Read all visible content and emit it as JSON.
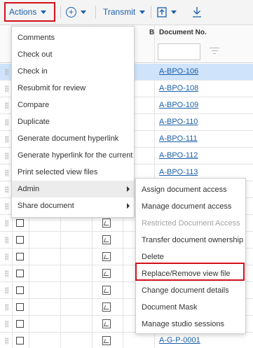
{
  "toolbar": {
    "actions_label": "Actions",
    "add_symbol": "+",
    "transmit_label": "Transmit"
  },
  "grid": {
    "header_partial": "B",
    "doc_no_header": "Document No.",
    "rows": [
      {
        "doc": "A-BPO-106",
        "selected": true
      },
      {
        "doc": "A-BPO-108"
      },
      {
        "doc": "A-BPO-109"
      },
      {
        "doc": "A-BPO-110"
      },
      {
        "doc": "A-BPO-111"
      },
      {
        "doc": "A-BPO-112"
      },
      {
        "doc": "A-BPO-113"
      },
      {
        "doc": ""
      },
      {
        "doc": ""
      },
      {
        "doc": ""
      },
      {
        "doc": ""
      },
      {
        "doc": ""
      },
      {
        "doc": ""
      },
      {
        "doc": ""
      },
      {
        "doc": ""
      },
      {
        "doc": ""
      },
      {
        "doc": "A-G-P-0001"
      }
    ]
  },
  "actions_menu": {
    "items": [
      "Comments",
      "Check out",
      "Check in",
      "Resubmit for review",
      "Compare",
      "Duplicate",
      "Generate document hyperlink",
      "Generate hyperlink for the current r...",
      "Print selected view files",
      "Admin",
      "Share document"
    ]
  },
  "admin_menu": {
    "items": [
      "Assign document access",
      "Manage document access",
      "Restricted Document Access",
      "Transfer document ownership",
      "Delete",
      "Replace/Remove view file",
      "Change document details",
      "Document Mask",
      "Manage studio sessions"
    ]
  },
  "colors": {
    "link": "#1a5fa8",
    "highlight_border": "#d3101a",
    "selected_row": "#cfe3fb"
  }
}
